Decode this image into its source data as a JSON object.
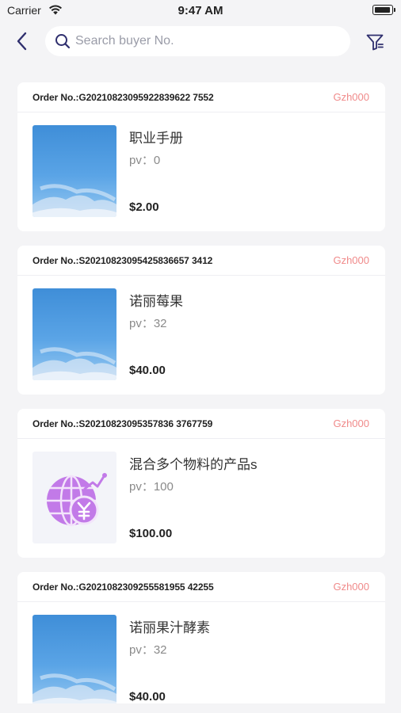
{
  "status_bar": {
    "carrier": "Carrier",
    "time": "9:47 AM"
  },
  "search": {
    "placeholder": "Search buyer No."
  },
  "icons": {
    "back": "chevron-left-icon",
    "search": "search-icon",
    "filter": "filter-icon"
  },
  "colors": {
    "accent": "#2f2f6e",
    "tag": "#f08a8a",
    "price": "#222222"
  },
  "orders": [
    {
      "order_no": "Order No.:G20210823095922839622 7552",
      "tag": "Gzh000",
      "name": "职业手册",
      "pv": "pv：0",
      "price": "$2.00",
      "image": "sky"
    },
    {
      "order_no": "Order No.:S20210823095425836657 3412",
      "tag": "Gzh000",
      "name": "诺丽莓果",
      "pv": "pv：32",
      "price": "$40.00",
      "image": "sky"
    },
    {
      "order_no": "Order No.:S20210823095357836 3767759",
      "tag": "Gzh000",
      "name": "混合多个物料的产品s",
      "pv": "pv：100",
      "price": "$100.00",
      "image": "globe"
    },
    {
      "order_no": "Order No.:G2021082309255581955 42255",
      "tag": "Gzh000",
      "name": "诺丽果汁酵素",
      "pv": "pv：32",
      "price": "$40.00",
      "image": "sky"
    }
  ]
}
